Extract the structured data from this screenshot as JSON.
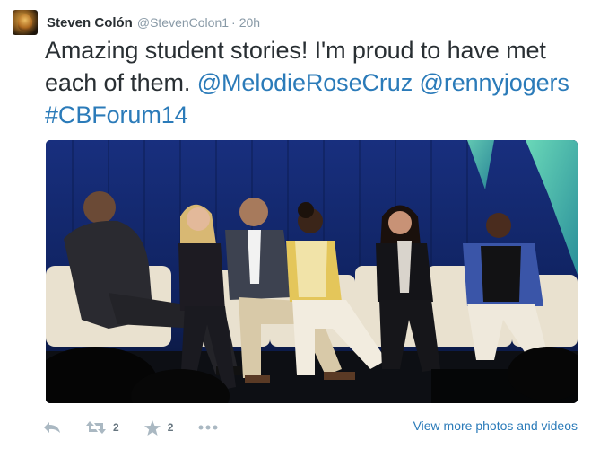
{
  "tweet": {
    "author_name": "Steven Colón",
    "author_handle": "@StevenColon1",
    "separator": "·",
    "time": "20h",
    "text_plain": "Amazing student stories! I'm proud to have met each of them.",
    "mentions": [
      "@MelodieRoseCruz",
      "@rennyjogers"
    ],
    "hashtag": "#CBForum14"
  },
  "actions": {
    "reply_icon": "reply-icon",
    "retweet_icon": "retweet-icon",
    "retweet_count": "2",
    "favorite_icon": "star-icon",
    "favorite_count": "2",
    "more_icon": "more-icon"
  },
  "media": {
    "view_more_label": "View more photos and videos"
  },
  "colors": {
    "link": "#2b7bb9",
    "muted": "#8899a6",
    "text": "#292f33",
    "stage_backdrop": "#13296e"
  }
}
